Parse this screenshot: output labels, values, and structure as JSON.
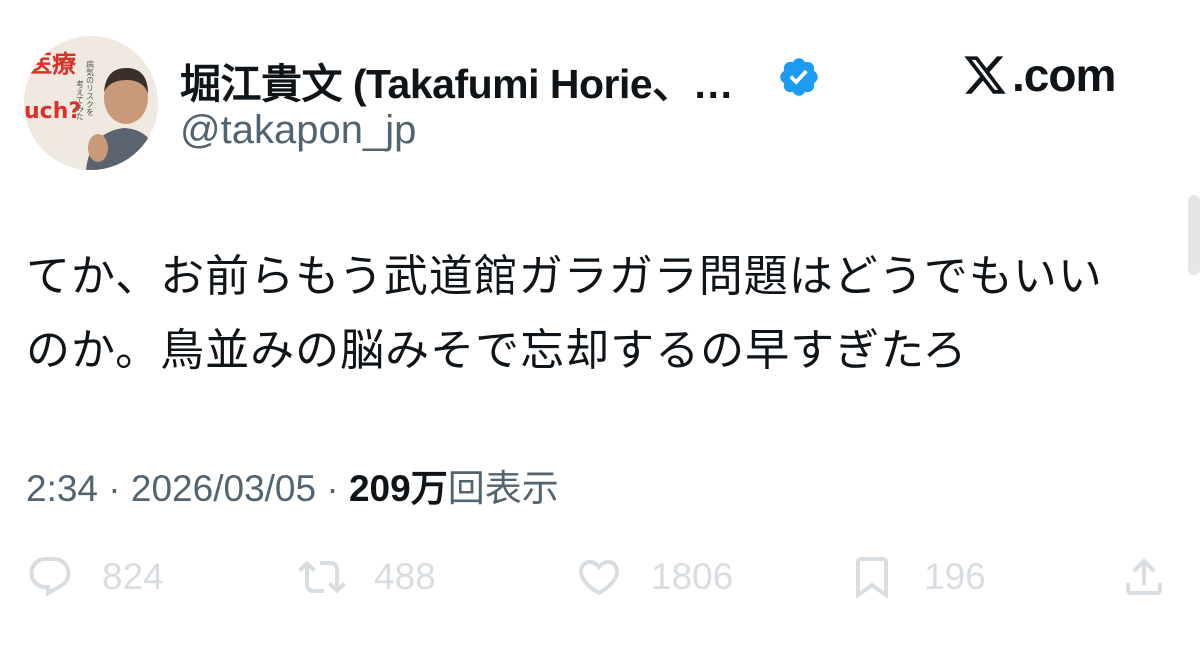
{
  "author": {
    "display_name": "堀江貴文 (Takafumi Horie、…",
    "handle": "@takapon_jp",
    "verified": true,
    "avatar_book_text": {
      "line1": "医療",
      "line2": "uch?",
      "vertical1": "病気のリスクを",
      "vertical2": "考えてみた"
    }
  },
  "brand": {
    "text": ".com",
    "icon": "x-logo-icon"
  },
  "tweet": {
    "lines": [
      "てか、お前らもう武道館ガラガラ問題はどうでもいい",
      "のか。鳥並みの脳みそで忘却するの早すぎたろ"
    ]
  },
  "meta": {
    "time": "2:34",
    "separator": "·",
    "date": "2026/03/05",
    "views_count": "209",
    "views_unit": "万",
    "views_label": "回表示"
  },
  "actions": [
    {
      "icon": "reply-icon",
      "count": "824"
    },
    {
      "icon": "retweet-icon",
      "count": "488"
    },
    {
      "icon": "like-icon",
      "count": "1806"
    },
    {
      "icon": "bookmark-icon",
      "count": "196"
    },
    {
      "icon": "share-icon",
      "count": ""
    }
  ],
  "colors": {
    "accent": "#1d9bf0",
    "muted": "#536471",
    "faded": "#d8dde1"
  }
}
